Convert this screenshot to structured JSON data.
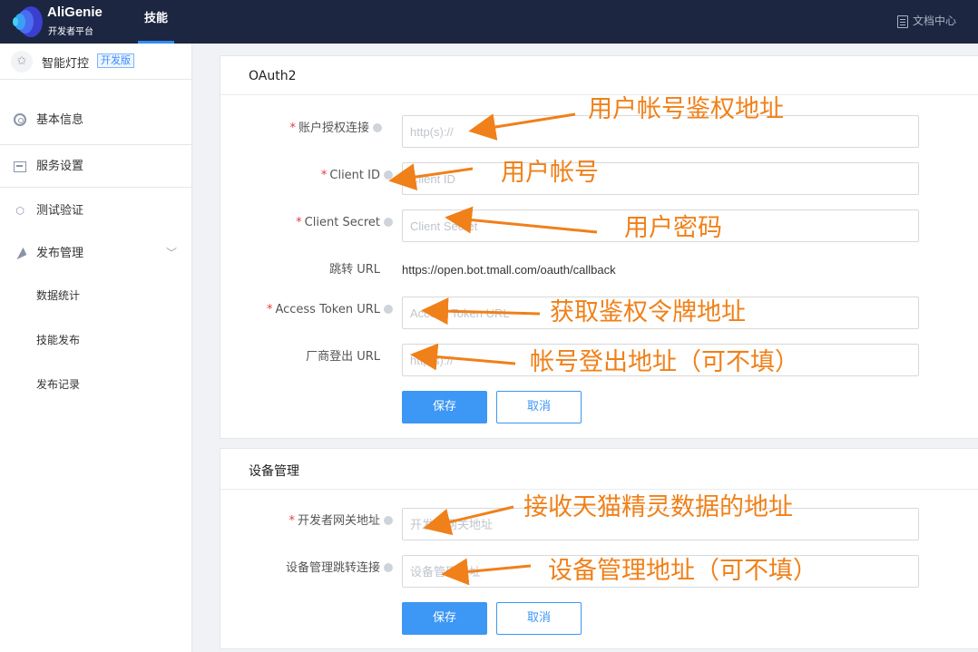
{
  "header": {
    "logo_name": "AliGenie",
    "logo_sub": "开发者平台",
    "nav_tab": "技能",
    "docs_link": "文档中心",
    "icons": {
      "logo": "aligenie-logo-icon",
      "docs": "document-icon"
    }
  },
  "sidebar": {
    "skill_name": "智能灯控",
    "skill_tag": "开发版",
    "items": [
      {
        "label": "基本信息",
        "icon": "ring-icon"
      },
      {
        "label": "服务设置",
        "icon": "server-icon",
        "active": true
      },
      {
        "label": "测试验证",
        "icon": "test-icon"
      },
      {
        "label": "发布管理",
        "icon": "send-icon",
        "expanded": true
      }
    ],
    "sub_items": [
      "数据统计",
      "技能发布",
      "发布记录"
    ]
  },
  "oauth": {
    "title": "OAuth2",
    "fields": {
      "account_auth": {
        "label": "账户授权连接",
        "placeholder": "http(s)://",
        "required": true
      },
      "client_id": {
        "label": "Client ID",
        "placeholder": "Client ID",
        "required": true
      },
      "client_secret": {
        "label": "Client Secret",
        "placeholder": "Client Secret",
        "required": true
      },
      "redirect": {
        "label": "跳转 URL",
        "value": "https://open.bot.tmall.com/oauth/callback"
      },
      "access_token": {
        "label": "Access Token URL",
        "placeholder": "Access Token URL",
        "required": true
      },
      "logout": {
        "label": "厂商登出 URL",
        "placeholder": "http(s)://"
      }
    },
    "save_label": "保存",
    "cancel_label": "取消"
  },
  "device": {
    "title": "设备管理",
    "fields": {
      "gateway": {
        "label": "开发者网关地址",
        "placeholder": "开发者网关地址",
        "required": true
      },
      "redirect": {
        "label": "设备管理跳转连接",
        "placeholder": "设备管理地址"
      }
    },
    "save_label": "保存",
    "cancel_label": "取消"
  },
  "annotations": {
    "account_auth": "用户帐号鉴权地址",
    "client_id": "用户帐号",
    "client_secret": "用户密码",
    "access_token": "获取鉴权令牌地址",
    "logout": "帐号登出地址（可不填）",
    "gateway": "接收天猫精灵数据的地址",
    "device_redirect": "设备管理地址（可不填）"
  },
  "colors": {
    "topbar": "#1c2640",
    "primary": "#3c97f5",
    "annotation": "#f08019",
    "required": "#e83a3a"
  }
}
